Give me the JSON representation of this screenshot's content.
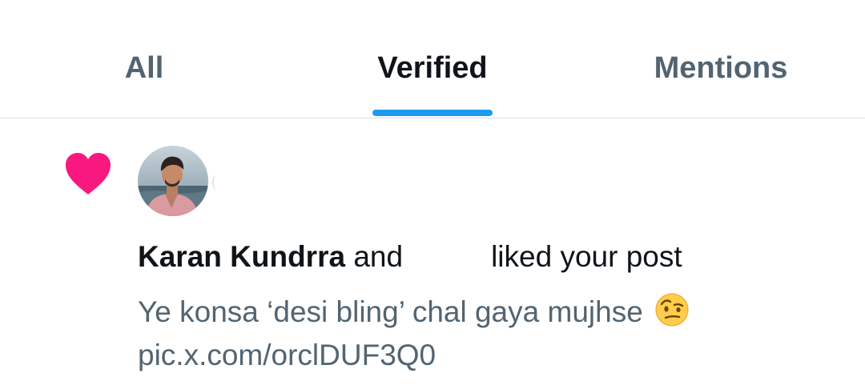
{
  "tabs": [
    {
      "label": "All",
      "active": false
    },
    {
      "label": "Verified",
      "active": true
    },
    {
      "label": "Mentions",
      "active": false
    }
  ],
  "accent_color": "#1d9bf0",
  "notification": {
    "type_icon": "heart-icon",
    "type_icon_color": "#f91880",
    "avatar": "profile-avatar",
    "user_name": "Karan Kundrra",
    "connector": "and",
    "action": "liked your post",
    "post_text": "Ye konsa ‘desi bling’ chal gaya mujhse",
    "post_emoji": "face-with-raised-eyebrow-icon",
    "post_link": "pic.x.com/orclDUF3Q0"
  }
}
